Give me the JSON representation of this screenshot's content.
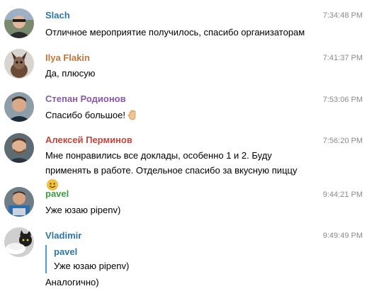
{
  "messages": [
    {
      "author": "Slach",
      "author_color": "#2b77a8",
      "time": "7:34:48 PM",
      "text": "Отличное мероприятие получилось, спасибо организаторам"
    },
    {
      "author": "Ilya Flakin",
      "author_color": "#c3773a",
      "time": "7:41:37 PM",
      "text": "Да, плюсую"
    },
    {
      "author": "Степан Родионов",
      "author_color": "#8a5aa9",
      "time": "7:53:06 PM",
      "text": "Спасибо большое!",
      "emoji": "raised-hand-emoji"
    },
    {
      "author": "Алексей Перминов",
      "author_color": "#c0463a",
      "time": "7:56:20 PM",
      "text": "Мне понравились все доклады, особенно 1 и 2. Буду применять в работе. Отдельное спасибо за вкусную пиццу",
      "emoji": "smiling-face-emoji"
    },
    {
      "author": "pavel",
      "author_color": "#3e9c3e",
      "time": "9:44:21 PM",
      "text": "Уже юзаю pipenv)"
    },
    {
      "author": "Vladimir",
      "author_color": "#2b77a8",
      "time": "9:49:49 PM",
      "reply": {
        "author": "pavel",
        "text": "Уже юзаю pipenv)"
      },
      "text": "Аналогично)"
    }
  ]
}
